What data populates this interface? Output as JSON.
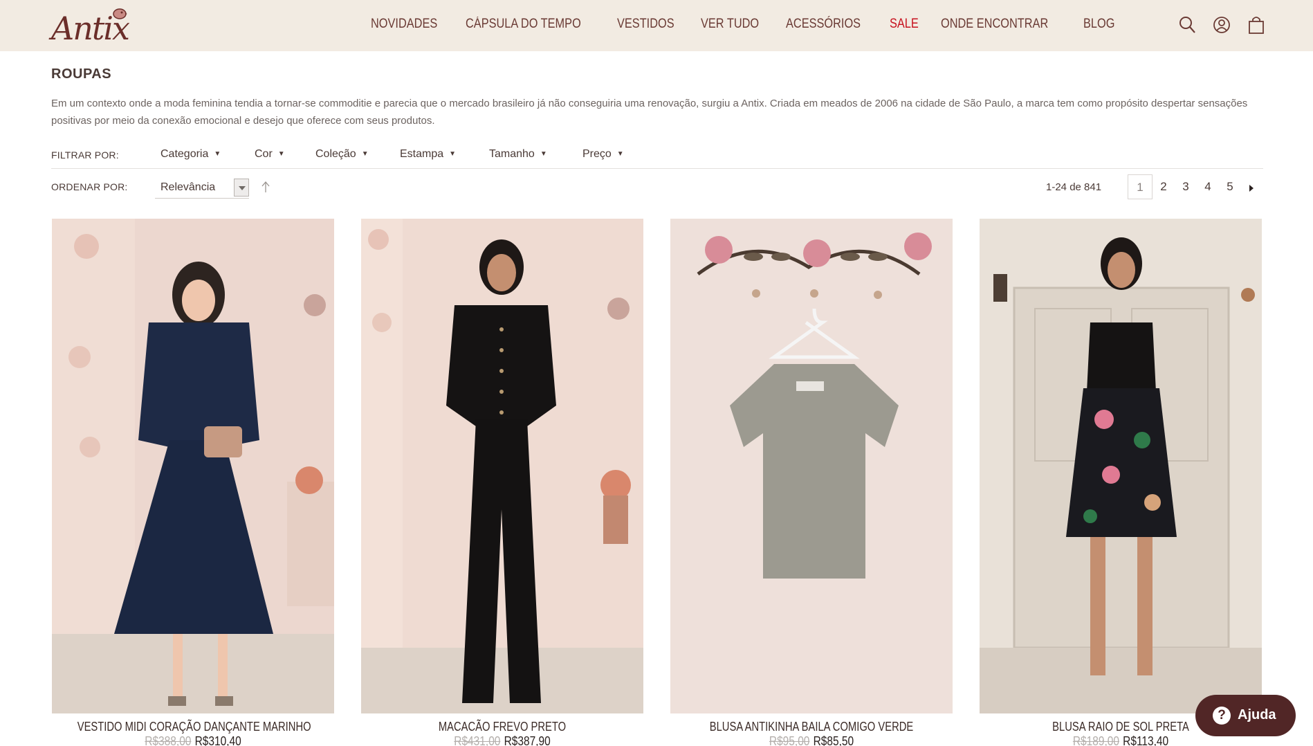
{
  "brand": {
    "logo_text": "Antix"
  },
  "nav": {
    "items": [
      {
        "label": "NOVIDADES"
      },
      {
        "label": "CÁPSULA DO TEMPO"
      },
      {
        "label": "VESTIDOS"
      },
      {
        "label": "VER TUDO"
      },
      {
        "label": "ACESSÓRIOS"
      },
      {
        "label": "SALE"
      },
      {
        "label": "ONDE ENCONTRAR"
      },
      {
        "label": "BLOG"
      }
    ],
    "sale_color": "#c7101d"
  },
  "header_icons": [
    "search-icon",
    "account-icon",
    "bag-icon"
  ],
  "category": {
    "title": "ROUPAS",
    "description": "Em um contexto onde a moda feminina tendia a tornar-se commoditie e parecia que o mercado brasileiro já não conseguiria uma renovação, surgiu a Antix. Criada em meados de 2006 na cidade de São Paulo, a marca tem como propósito despertar sensações positivas por meio da conexão emocional e desejo que oferece com seus produtos."
  },
  "filters": {
    "label": "FILTRAR POR:",
    "items": [
      "Categoria",
      "Cor",
      "Coleção",
      "Estampa",
      "Tamanho",
      "Preço"
    ]
  },
  "sort": {
    "label": "ORDENAR POR:",
    "value": "Relevância"
  },
  "results": {
    "count_text": "1-24 de 841"
  },
  "pagination": {
    "pages": [
      "1",
      "2",
      "3",
      "4",
      "5"
    ],
    "current": "1"
  },
  "products": [
    {
      "name": "VESTIDO MIDI CORAÇÃO DANÇANTE MARINHO",
      "old_price": "R$388,00",
      "price": "R$310,40"
    },
    {
      "name": "MACACÃO FREVO PRETO",
      "old_price": "R$431,00",
      "price": "R$387,90"
    },
    {
      "name": "BLUSA ANTIKINHA BAILA COMIGO VERDE",
      "old_price": "R$95,00",
      "price": "R$85,50"
    },
    {
      "name": "BLUSA RAIO DE SOL PRETA",
      "old_price": "R$189,00",
      "price": "R$113,40"
    }
  ],
  "help": {
    "label": "Ajuda",
    "icon": "?"
  },
  "colors": {
    "header_bg": "#f2ebe2",
    "brand": "#6b2e2a",
    "help_bg": "#512626"
  }
}
